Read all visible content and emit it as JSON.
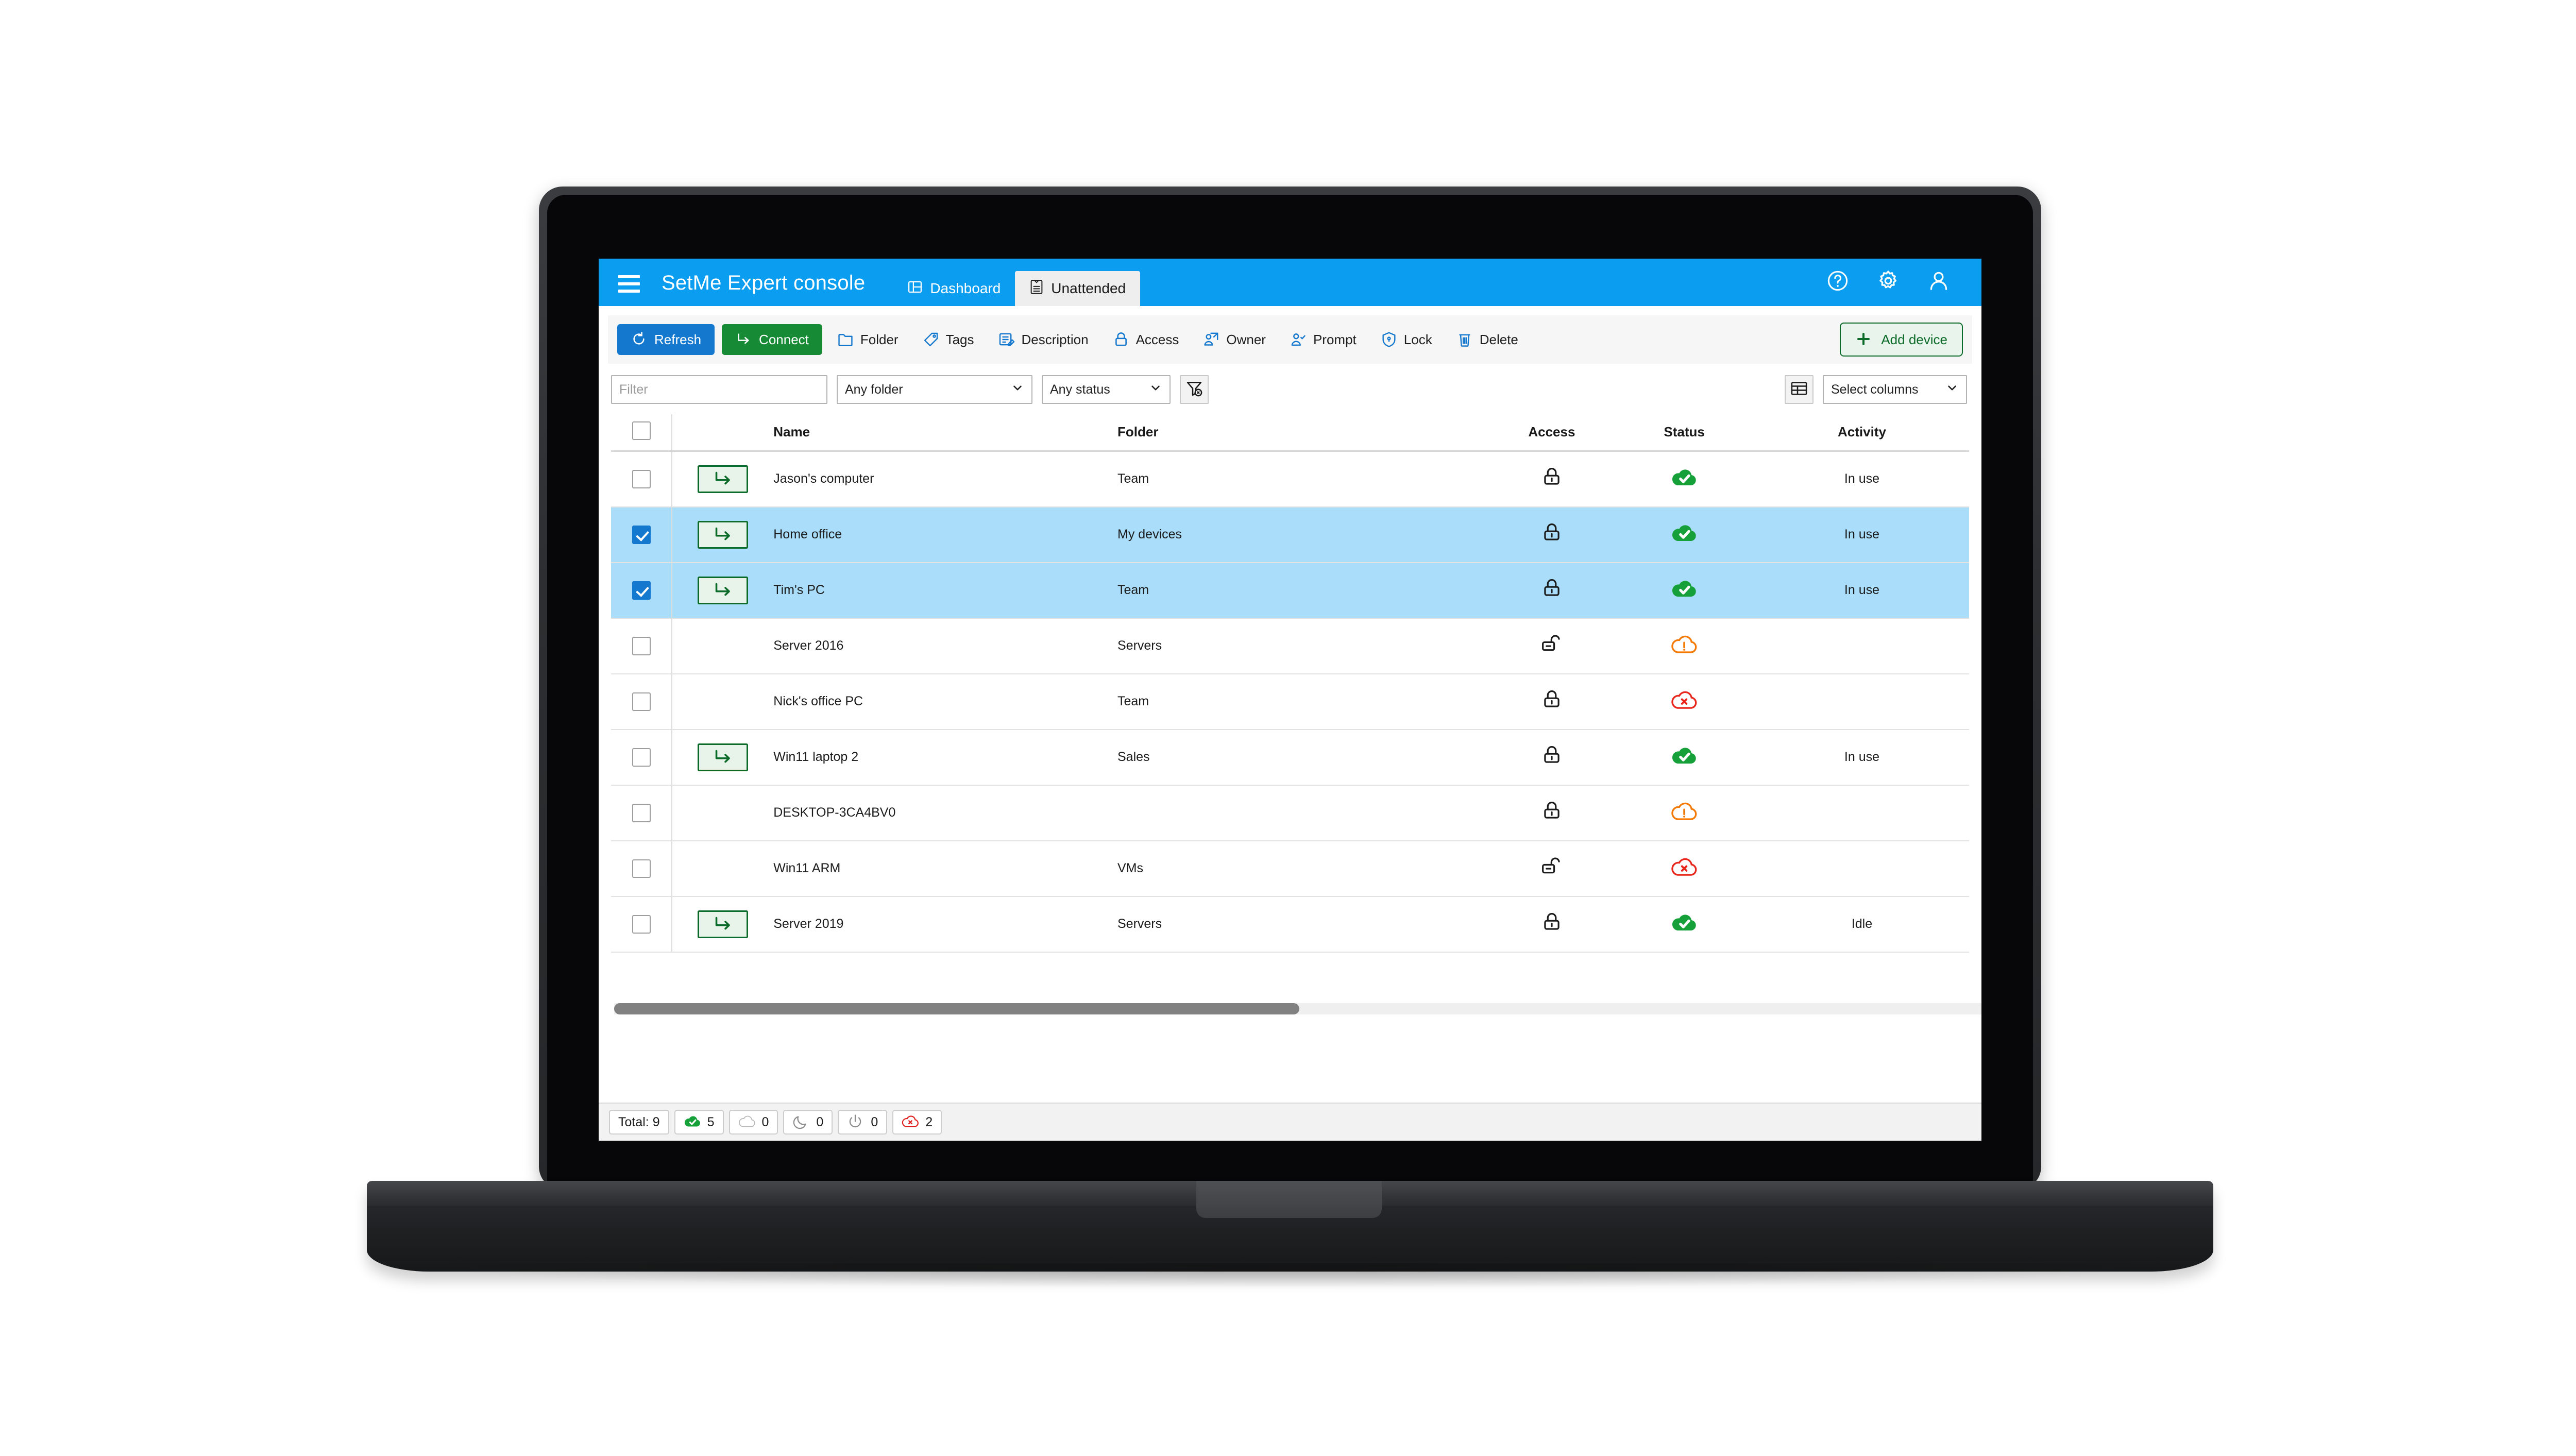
{
  "header": {
    "menu_icon": "hamburger-menu-icon",
    "title": "SetMe Expert console",
    "tabs": [
      {
        "label": "Dashboard",
        "icon": "dashboard-icon",
        "active": true
      },
      {
        "label": "Unattended",
        "icon": "list-icon",
        "active": false
      }
    ],
    "actions": [
      {
        "name": "help-icon",
        "label": "?"
      },
      {
        "name": "gear-icon",
        "label": ""
      },
      {
        "name": "user-account-icon",
        "label": ""
      }
    ],
    "bg_color": "#0b9df0"
  },
  "toolbar": {
    "refresh_label": "Refresh",
    "connect_label": "Connect",
    "folder_label": "Folder",
    "tags_label": "Tags",
    "description_label": "Description",
    "access_label": "Access",
    "owner_label": "Owner",
    "prompt_label": "Prompt",
    "lock_label": "Lock",
    "delete_label": "Delete",
    "add_device_label": "Add device",
    "primary_color": "#1478cf",
    "connect_color": "#168a34",
    "add_device_color": "#0d6b2a"
  },
  "filterbar": {
    "filter_placeholder": "Filter",
    "filter_value": "",
    "folder_select_value": "Any folder",
    "status_select_value": "Any status",
    "clear_filter_icon": "clear-filter-icon",
    "grid_view_icon": "table-grid-icon",
    "select_columns_value": "Select columns"
  },
  "table": {
    "columns": [
      "",
      "",
      "Name",
      "Folder",
      "Access",
      "Status",
      "Activity"
    ],
    "header_select_all_checked": false,
    "rows": [
      {
        "checked": false,
        "connect": true,
        "name": "Jason's computer",
        "folder": "Team",
        "access": "locked",
        "status": "online",
        "activity": "In use"
      },
      {
        "checked": true,
        "connect": true,
        "name": "Home office",
        "folder": "My devices",
        "access": "locked",
        "status": "online",
        "activity": "In use"
      },
      {
        "checked": true,
        "connect": true,
        "name": "Tim's PC",
        "folder": "Team",
        "access": "locked",
        "status": "online",
        "activity": "In use"
      },
      {
        "checked": false,
        "connect": false,
        "name": "Server 2016",
        "folder": "Servers",
        "access": "unlocked",
        "status": "warning",
        "activity": ""
      },
      {
        "checked": false,
        "connect": false,
        "name": "Nick's office PC",
        "folder": "Team",
        "access": "locked",
        "status": "offline",
        "activity": ""
      },
      {
        "checked": false,
        "connect": true,
        "name": "Win11 laptop 2",
        "folder": "Sales",
        "access": "locked",
        "status": "online",
        "activity": "In use"
      },
      {
        "checked": false,
        "connect": false,
        "name": "DESKTOP-3CA4BV0",
        "folder": "",
        "access": "locked",
        "status": "warning",
        "activity": ""
      },
      {
        "checked": false,
        "connect": false,
        "name": "Win11 ARM",
        "folder": "VMs",
        "access": "unlocked",
        "status": "offline",
        "activity": ""
      },
      {
        "checked": false,
        "connect": true,
        "name": "Server 2019",
        "folder": "Servers",
        "access": "locked",
        "status": "online",
        "activity": "Idle"
      }
    ]
  },
  "statusbar": {
    "total_label": "Total: 9",
    "counts": [
      {
        "icon": "cloud-online-icon",
        "value": "5",
        "color": "#16a03a"
      },
      {
        "icon": "cloud-offline-icon",
        "value": "0",
        "color": "#b8b8b8"
      },
      {
        "icon": "moon-sleep-icon",
        "value": "0",
        "color": "#8c8c8c"
      },
      {
        "icon": "power-off-icon",
        "value": "0",
        "color": "#8c8c8c"
      },
      {
        "icon": "cloud-error-icon",
        "value": "2",
        "color": "#e01b1b"
      }
    ]
  },
  "status_colors": {
    "online": "#16a03a",
    "warning": "#f57a05",
    "offline": "#e8261c"
  }
}
